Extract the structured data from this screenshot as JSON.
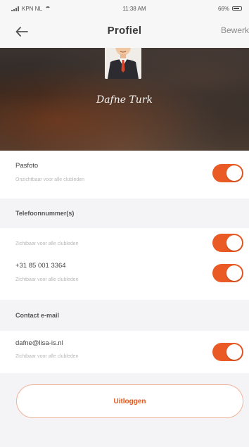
{
  "status_bar": {
    "carrier": "KPN NL",
    "time": "11:38 AM",
    "battery": "66%"
  },
  "nav": {
    "title": "Profiel",
    "edit_label": "Bewerk"
  },
  "profile": {
    "name": "Dafne Turk"
  },
  "settings": {
    "photo": {
      "title": "Pasfoto",
      "subtitle": "Onzichtbaar voor alle clubleden",
      "enabled": true
    },
    "phone_section_header": "Telefoonnummer(s)",
    "phone_visibility": {
      "subtitle": "Zichtbaar voor alle clubleden",
      "enabled": true
    },
    "phone_number": {
      "title": "+31 85 001 3364",
      "subtitle": "Zichtbaar voor alle clubleden",
      "enabled": true
    },
    "email_section_header": "Contact e-mail",
    "email": {
      "title": "dafne@lisa-is.nl",
      "subtitle": "Zichtbaar voor alle clubleden",
      "enabled": true
    }
  },
  "logout_label": "Uitloggen",
  "colors": {
    "accent": "#ea5a24",
    "background": "#f4f4f6"
  }
}
